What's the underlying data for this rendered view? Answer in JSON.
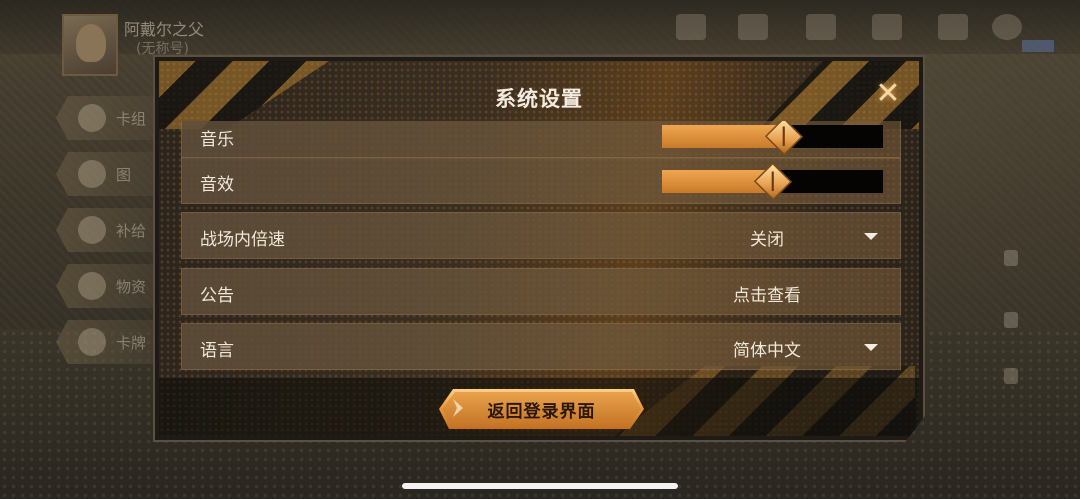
{
  "background": {
    "player_name": "阿戴尔之父",
    "player_sub": "(无称号)",
    "menu_items": [
      {
        "label": "卡组",
        "icon": "card-deck-icon"
      },
      {
        "label": "图",
        "icon": "flower-icon"
      },
      {
        "label": "补给",
        "icon": "parachute-icon"
      },
      {
        "label": "物资",
        "icon": "crate-icon"
      },
      {
        "label": "卡牌",
        "icon": "card-icon"
      }
    ]
  },
  "dialog": {
    "title": "系统设置",
    "close_icon": "close-icon",
    "settings": {
      "music": {
        "label": "音乐",
        "level": 0.55
      },
      "sound_effects": {
        "label": "音效",
        "level": 0.5
      },
      "battle_speed": {
        "label": "战场内倍速",
        "value": "关闭"
      },
      "announcement": {
        "label": "公告",
        "value": "点击查看"
      },
      "language": {
        "label": "语言",
        "value": "简体中文"
      }
    },
    "return_button": "返回登录界面"
  },
  "colors": {
    "accent": "#e8a050",
    "slider_fill": "#d88a36",
    "panel": "#1e1b17"
  }
}
